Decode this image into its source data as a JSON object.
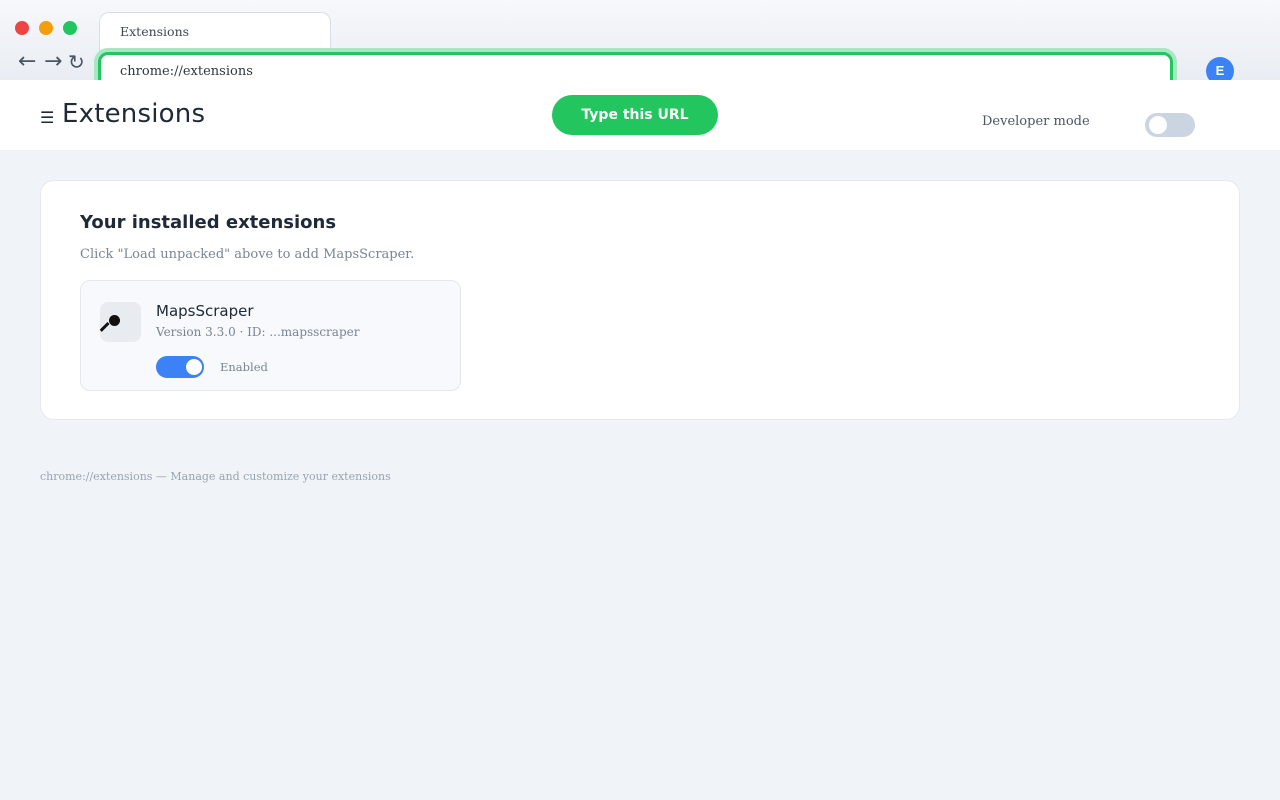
{
  "browser": {
    "tab_title": "Extensions",
    "address": "chrome://extensions",
    "nav_back": "←",
    "nav_forward": "→",
    "nav_reload": "↻",
    "avatar_initial": "E"
  },
  "hint": {
    "label": "Type this URL",
    "color": "#22c55e"
  },
  "header": {
    "menu_icon": "☰",
    "title": "Extensions",
    "developer_mode_label": "Developer mode",
    "developer_mode_on": false
  },
  "installed": {
    "title": "Your installed extensions",
    "subtitle": "Click \"Load unpacked\" above to add MapsScraper.",
    "extensions": [
      {
        "name": "MapsScraper",
        "version_line": "Version 3.3.0 · ID: ...mapsscraper",
        "status": "Enabled",
        "enabled": true,
        "icon": "map-pin-icon"
      }
    ]
  },
  "footer": {
    "note": "chrome://extensions — Manage and customize your extensions"
  },
  "colors": {
    "accent": "#22c55e",
    "toggle_on": "#3b82f6",
    "toggle_off": "#cbd5e1"
  }
}
